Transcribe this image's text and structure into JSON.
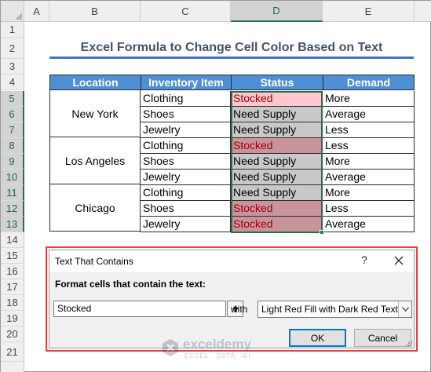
{
  "columns": [
    "A",
    "B",
    "C",
    "D",
    "E"
  ],
  "rows": [
    "1",
    "2",
    "3",
    "4",
    "5",
    "6",
    "7",
    "8",
    "9",
    "10",
    "11",
    "12",
    "13",
    "14",
    "15",
    "16",
    "17",
    "18",
    "19",
    "20",
    "21"
  ],
  "title": "Excel Formula to Change Cell Color Based on Text",
  "table": {
    "headers": {
      "location": "Location",
      "item": "Inventory Item",
      "status": "Status",
      "demand": "Demand"
    },
    "groups": [
      {
        "location": "New York",
        "rows": [
          {
            "item": "Clothing",
            "status": "Stocked",
            "demand": "More"
          },
          {
            "item": "Shoes",
            "status": "Need Supply",
            "demand": "Average"
          },
          {
            "item": "Jewelry",
            "status": "Need Supply",
            "demand": "Less"
          }
        ]
      },
      {
        "location": "Los Angeles",
        "rows": [
          {
            "item": "Clothing",
            "status": "Stocked",
            "demand": "Less"
          },
          {
            "item": "Shoes",
            "status": "Need Supply",
            "demand": "More"
          },
          {
            "item": "Jewelry",
            "status": "Need Supply",
            "demand": "Average"
          }
        ]
      },
      {
        "location": "Chicago",
        "rows": [
          {
            "item": "Clothing",
            "status": "Need Supply",
            "demand": "More"
          },
          {
            "item": "Shoes",
            "status": "Stocked",
            "demand": "Less"
          },
          {
            "item": "Jewelry",
            "status": "Stocked",
            "demand": "Average"
          }
        ]
      }
    ]
  },
  "dialog": {
    "title": "Text That Contains",
    "help": "?",
    "label": "Format cells that contain the text:",
    "input_value": "Stocked",
    "with_label": "with",
    "format_selected": "Light Red Fill with Dark Red Text",
    "ok_label": "OK",
    "cancel_label": "Cancel"
  },
  "watermark": {
    "name": "exceldemy",
    "tagline": "EXCEL · DATA · BI"
  },
  "colors": {
    "header_fill": "#4f8fd3",
    "stocked_light": "#ffc7ce",
    "stocked_dark": "#c9939c",
    "need_supply": "#c8c8c8",
    "title_text": "#44546a",
    "title_rule": "#4472c4",
    "selection": "#217346",
    "dialog_highlight": "#e04040"
  }
}
